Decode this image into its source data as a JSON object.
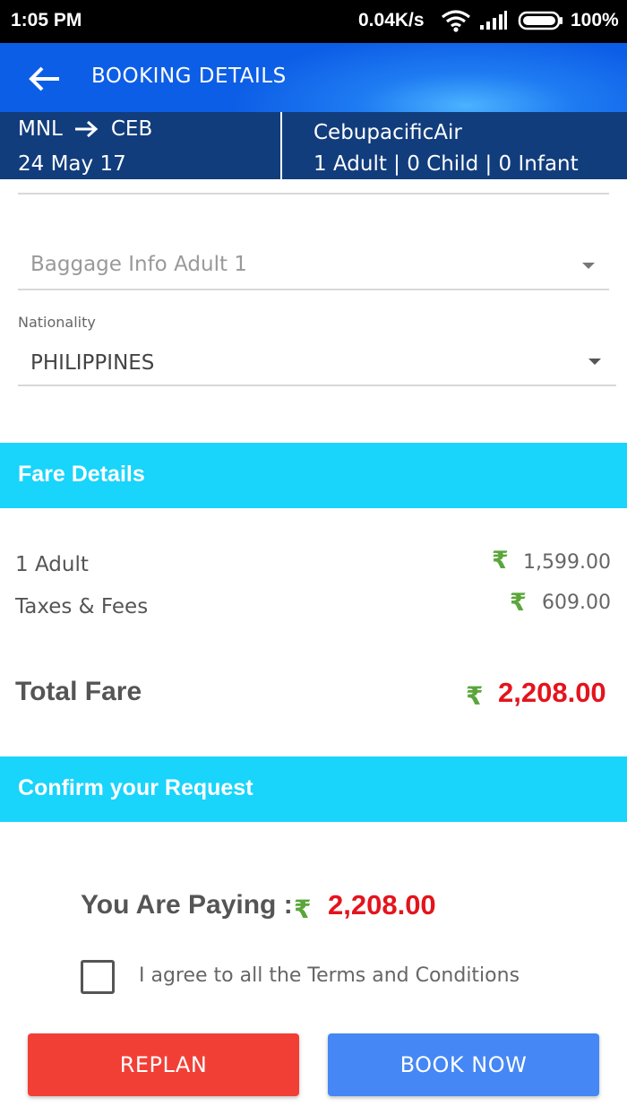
{
  "status_bar": {
    "time": "1:05 PM",
    "network_speed": "0.04K/s",
    "battery": "100%",
    "icons": [
      "wifi-icon",
      "signal-icon",
      "battery-icon"
    ]
  },
  "app_bar": {
    "title": "BOOKING DETAILS",
    "back_icon": "back-arrow-icon"
  },
  "trip": {
    "origin": "MNL",
    "destination": "CEB",
    "date": "24 May 17",
    "airline": "CebupacificAir",
    "passengers": "1 Adult | 0 Child | 0 Infant"
  },
  "form": {
    "baggage_placeholder": "Baggage Info Adult 1",
    "nationality_label": "Nationality",
    "nationality_value": "PHILIPPINES"
  },
  "fare_details": {
    "heading": "Fare Details",
    "currency_symbol": "₹",
    "rows": [
      {
        "label": "1 Adult",
        "amount": "1,599.00"
      },
      {
        "label": "Taxes & Fees",
        "amount": "609.00"
      }
    ],
    "total_label": "Total Fare",
    "total_amount": "2,208.00"
  },
  "confirm": {
    "heading": "Confirm your Request",
    "paying_label": "You Are Paying :",
    "paying_amount": "2,208.00",
    "terms_text": "I agree to all the Terms and Conditions",
    "terms_checked": false
  },
  "actions": {
    "replan_label": "REPLAN",
    "book_label": "BOOK NOW"
  },
  "colors": {
    "section_bar": "#19d4fb",
    "trip_bar": "#123d7d",
    "total_amount": "#e4141c",
    "rupee": "#5aa63a",
    "replan_button": "#f23f36",
    "book_button": "#4587f4"
  }
}
